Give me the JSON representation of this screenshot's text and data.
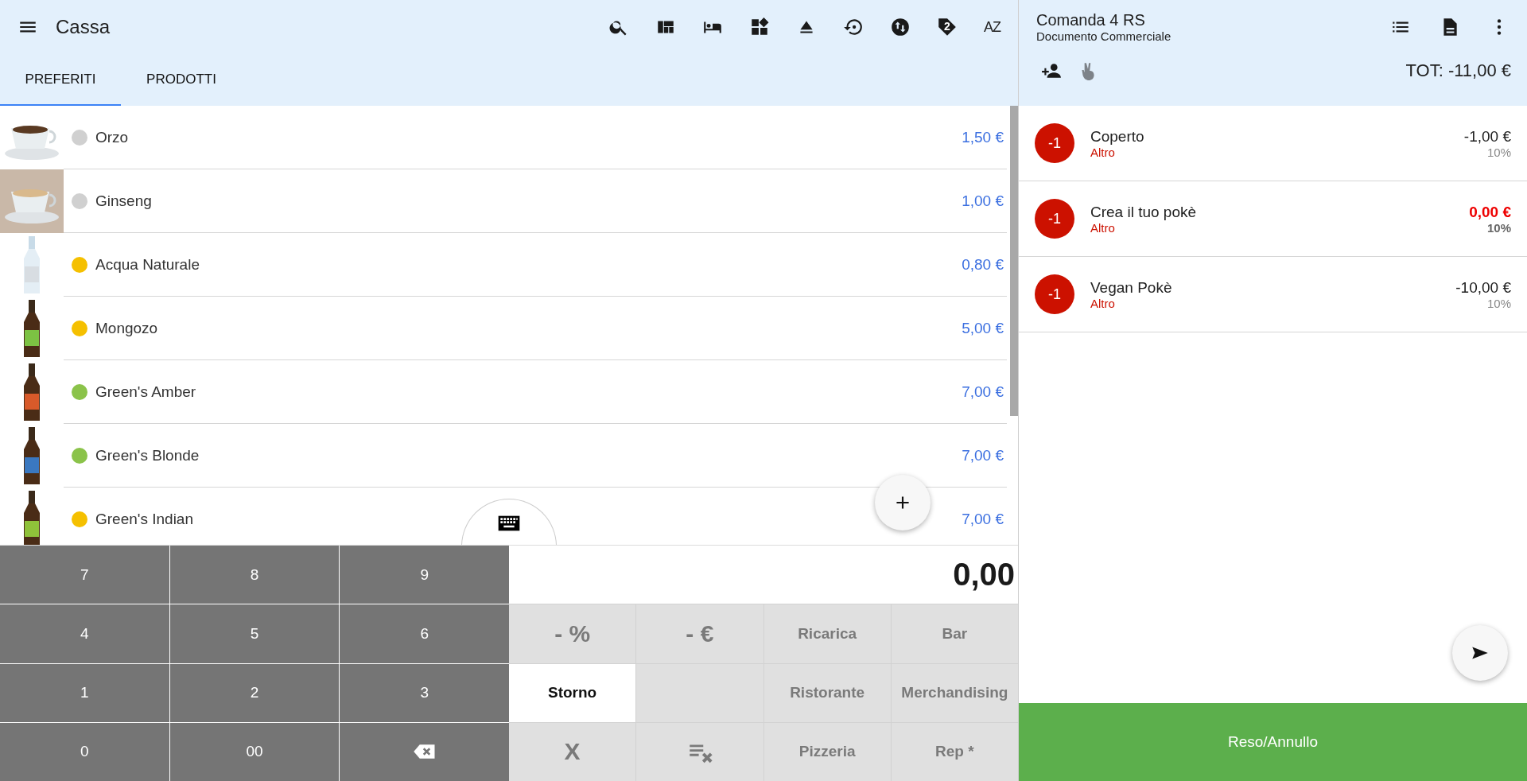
{
  "app_bar": {
    "title": "Cassa",
    "tag_badge": "2",
    "sort_label": "AZ"
  },
  "tabs": [
    {
      "label": "PREFERITI",
      "selected": true
    },
    {
      "label": "PRODOTTI",
      "selected": false
    }
  ],
  "products": [
    {
      "name": "Orzo",
      "price": "1,50 €",
      "color": "#d0d0d0"
    },
    {
      "name": "Ginseng",
      "price": "1,00 €",
      "color": "#d0d0d0"
    },
    {
      "name": "Acqua Naturale",
      "price": "0,80 €",
      "color": "#f5c000"
    },
    {
      "name": "Mongozo",
      "price": "5,00 €",
      "color": "#f5c000"
    },
    {
      "name": "Green's Amber",
      "price": "7,00 €",
      "color": "#8bc34a"
    },
    {
      "name": "Green's Blonde",
      "price": "7,00 €",
      "color": "#8bc34a"
    },
    {
      "name": "Green's Indian",
      "price": "7,00 €",
      "color": "#f5c000"
    }
  ],
  "numpad": [
    {
      "kind": "text",
      "label": "7"
    },
    {
      "kind": "text",
      "label": "8"
    },
    {
      "kind": "text",
      "label": "9"
    },
    {
      "kind": "text",
      "label": "4"
    },
    {
      "kind": "text",
      "label": "5"
    },
    {
      "kind": "text",
      "label": "6"
    },
    {
      "kind": "text",
      "label": "1"
    },
    {
      "kind": "text",
      "label": "2"
    },
    {
      "kind": "text",
      "label": "3"
    },
    {
      "kind": "text",
      "label": "0"
    },
    {
      "kind": "text",
      "label": "00"
    },
    {
      "kind": "backspace"
    }
  ],
  "display": "0,00",
  "function_keys": [
    {
      "kind": "big",
      "label": "- %",
      "selected": false
    },
    {
      "kind": "big",
      "label": "- €",
      "selected": false
    },
    {
      "kind": "text",
      "label": "Ricarica",
      "selected": false
    },
    {
      "kind": "text",
      "label": "Bar",
      "selected": false
    },
    {
      "kind": "text",
      "label": "Storno",
      "selected": true
    },
    {
      "kind": "blank",
      "selected": false
    },
    {
      "kind": "text",
      "label": "Ristorante",
      "selected": false
    },
    {
      "kind": "text",
      "label": "Merchandising",
      "selected": false
    },
    {
      "kind": "big",
      "label": "X",
      "selected": false
    },
    {
      "kind": "clear",
      "selected": false
    },
    {
      "kind": "text",
      "label": "Pizzeria",
      "selected": false
    },
    {
      "kind": "text",
      "label": "Rep *",
      "selected": false
    }
  ],
  "order": {
    "title": "Comanda 4 RS",
    "subtitle": "Documento Commerciale",
    "total": "TOT: -11,00 €",
    "items": [
      {
        "qty": "-1",
        "name": "Coperto",
        "category": "Altro",
        "price": "-1,00 €",
        "vat": "10%",
        "highlight": false
      },
      {
        "qty": "-1",
        "name": "Crea il tuo pokè",
        "category": "Altro",
        "price": "0,00 €",
        "vat": "10%",
        "highlight": true
      },
      {
        "qty": "-1",
        "name": "Vegan Pokè",
        "category": "Altro",
        "price": "-10,00 €",
        "vat": "10%",
        "highlight": false
      }
    ],
    "action": "Reso/Annullo"
  }
}
